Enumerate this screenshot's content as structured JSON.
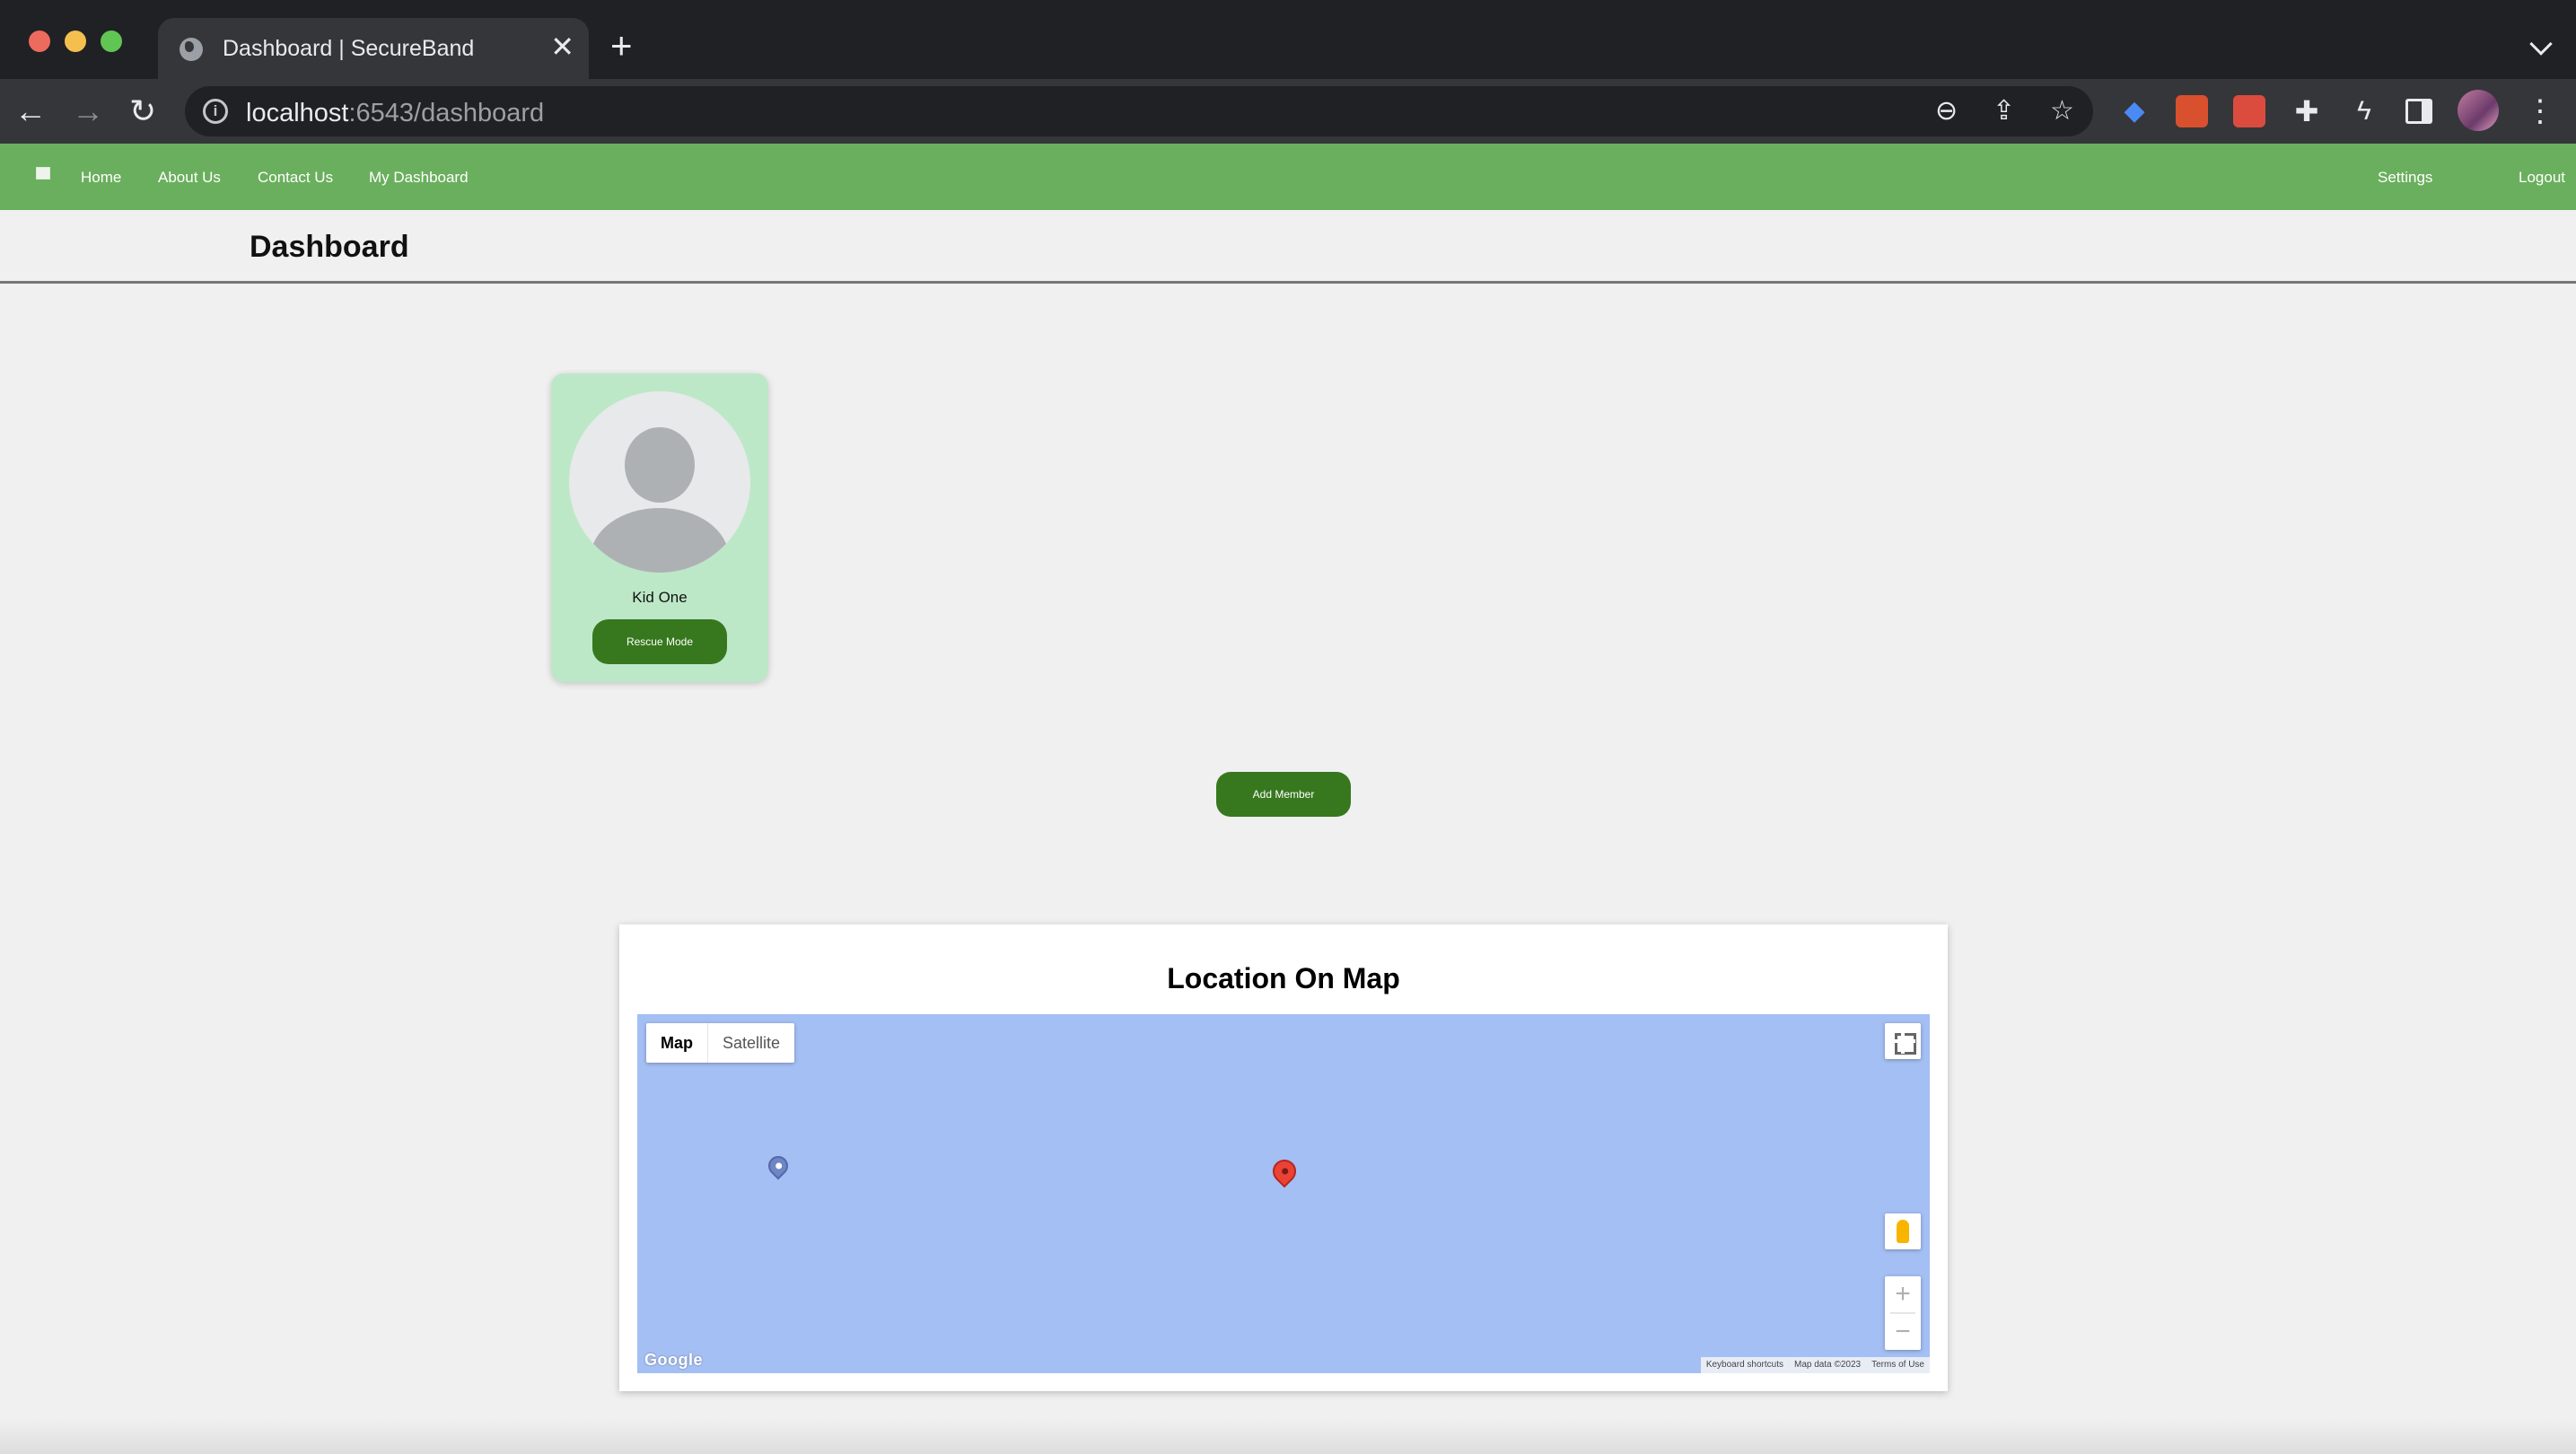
{
  "browser": {
    "tab_title": "Dashboard | SecureBand",
    "tab_close": "✕",
    "new_tab": "+",
    "url_host": "localhost",
    "url_path": ":6543/dashboard"
  },
  "navbar": {
    "links": [
      "Home",
      "About Us",
      "Contact Us",
      "My Dashboard"
    ],
    "settings": "Settings",
    "logout": "Logout",
    "background": "#6aaf5d"
  },
  "dashboard": {
    "title": "Dashboard"
  },
  "members": [
    {
      "name": "Kid One",
      "action": "Rescue Mode"
    }
  ],
  "add_member_label": "Add Member",
  "map": {
    "title": "Location On Map",
    "type_map": "Map",
    "type_satellite": "Satellite",
    "zoom_in": "+",
    "zoom_out": "−",
    "logo": "Google",
    "attribution": {
      "shortcuts": "Keyboard shortcuts",
      "data": "Map data ©2023",
      "terms": "Terms of Use"
    }
  },
  "colors": {
    "accent_button": "#37781e",
    "card_background": "#bde8c8",
    "map_water": "#a4bff4",
    "marker": "#ea4335"
  }
}
